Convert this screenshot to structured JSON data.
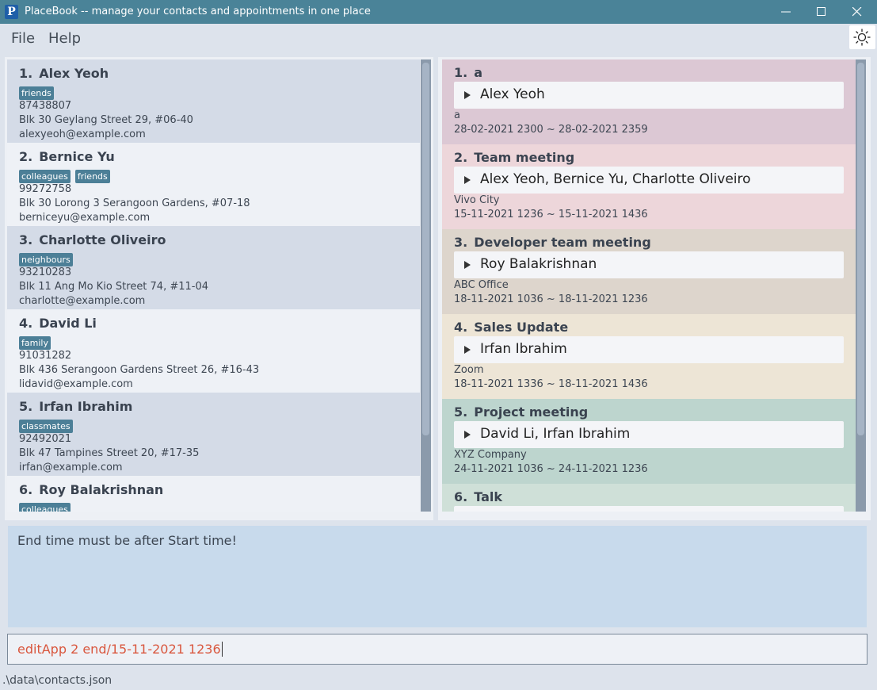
{
  "window": {
    "logo_letter": "P",
    "title": "PlaceBook -- manage your contacts and appointments in one place"
  },
  "menu": {
    "file": "File",
    "help": "Help"
  },
  "persons": [
    {
      "index": "1.",
      "name": "Alex Yeoh",
      "tags": [
        "friends"
      ],
      "phone": "87438807",
      "address": "Blk 30 Geylang Street 29, #06-40",
      "email": "alexyeoh@example.com"
    },
    {
      "index": "2.",
      "name": "Bernice Yu",
      "tags": [
        "colleagues",
        "friends"
      ],
      "phone": "99272758",
      "address": "Blk 30 Lorong 3 Serangoon Gardens, #07-18",
      "email": "berniceyu@example.com"
    },
    {
      "index": "3.",
      "name": "Charlotte Oliveiro",
      "tags": [
        "neighbours"
      ],
      "phone": "93210283",
      "address": "Blk 11 Ang Mo Kio Street 74, #11-04",
      "email": "charlotte@example.com"
    },
    {
      "index": "4.",
      "name": "David Li",
      "tags": [
        "family"
      ],
      "phone": "91031282",
      "address": "Blk 436 Serangoon Gardens Street 26, #16-43",
      "email": "lidavid@example.com"
    },
    {
      "index": "5.",
      "name": "Irfan Ibrahim",
      "tags": [
        "classmates"
      ],
      "phone": "92492021",
      "address": "Blk 47 Tampines Street 20, #17-35",
      "email": "irfan@example.com"
    },
    {
      "index": "6.",
      "name": "Roy Balakrishnan",
      "tags": [
        "colleagues"
      ],
      "phone": "",
      "address": "",
      "email": ""
    }
  ],
  "appointments": [
    {
      "index": "1.",
      "title": "a",
      "attendees": "Alex Yeoh",
      "location": "a",
      "time": "28-02-2021 2300  ~  28-02-2021 2359",
      "color": "#dcc8d4"
    },
    {
      "index": "2.",
      "title": "Team meeting",
      "attendees": "Alex Yeoh, Bernice Yu, Charlotte Oliveiro",
      "location": "Vivo City",
      "time": "15-11-2021 1236  ~  15-11-2021 1436",
      "color": "#edd6da"
    },
    {
      "index": "3.",
      "title": "Developer team meeting",
      "attendees": "Roy Balakrishnan",
      "location": "ABC Office",
      "time": "18-11-2021 1036  ~  18-11-2021 1236",
      "color": "#ddd5cc"
    },
    {
      "index": "4.",
      "title": "Sales Update",
      "attendees": "Irfan Ibrahim",
      "location": "Zoom",
      "time": "18-11-2021 1336  ~  18-11-2021 1436",
      "color": "#ede5d6"
    },
    {
      "index": "5.",
      "title": "Project meeting",
      "attendees": "David Li, Irfan Ibrahim",
      "location": "XYZ Company",
      "time": "24-11-2021 1036  ~  24-11-2021 1236",
      "color": "#bdd5ce"
    },
    {
      "index": "6.",
      "title": "Talk",
      "attendees": "",
      "location": "",
      "time": "",
      "color": "#cfe0d8"
    }
  ],
  "result": {
    "message": "End time must be after Start time!"
  },
  "command": {
    "value": "editApp 2 end/15-11-2021 1236"
  },
  "status": {
    "file_path": ".\\data\\contacts.json"
  }
}
